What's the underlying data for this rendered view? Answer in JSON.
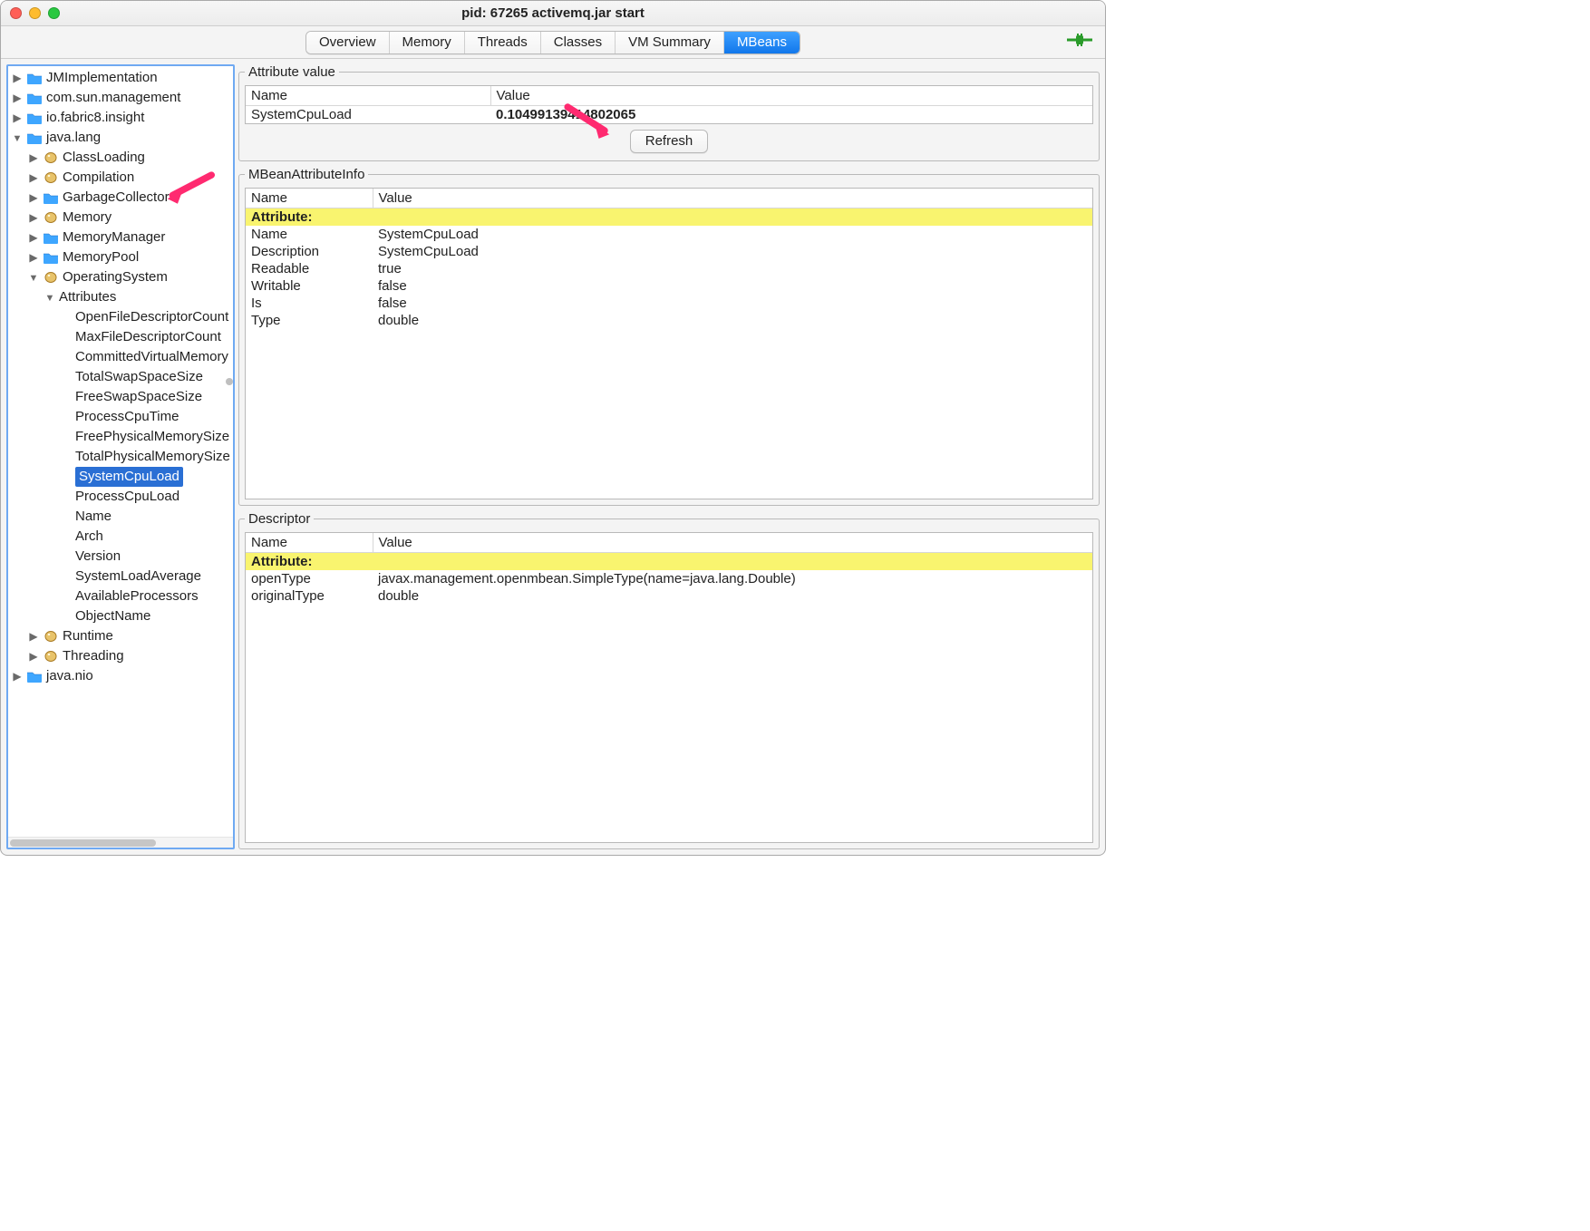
{
  "window": {
    "title": "pid: 67265 activemq.jar start"
  },
  "tabs": [
    "Overview",
    "Memory",
    "Threads",
    "Classes",
    "VM Summary",
    "MBeans"
  ],
  "active_tab": "MBeans",
  "tree": {
    "roots": [
      {
        "label": "JMImplementation",
        "icon": "folder",
        "expand": "closed"
      },
      {
        "label": "com.sun.management",
        "icon": "folder",
        "expand": "closed"
      },
      {
        "label": "io.fabric8.insight",
        "icon": "folder",
        "expand": "closed"
      },
      {
        "label": "java.lang",
        "icon": "folder",
        "expand": "open",
        "children": [
          {
            "label": "ClassLoading",
            "icon": "bean",
            "expand": "closed"
          },
          {
            "label": "Compilation",
            "icon": "bean",
            "expand": "closed"
          },
          {
            "label": "GarbageCollector",
            "icon": "folder",
            "expand": "closed",
            "annot_arrow": true
          },
          {
            "label": "Memory",
            "icon": "bean",
            "expand": "closed"
          },
          {
            "label": "MemoryManager",
            "icon": "folder",
            "expand": "closed"
          },
          {
            "label": "MemoryPool",
            "icon": "folder",
            "expand": "closed"
          },
          {
            "label": "OperatingSystem",
            "icon": "bean",
            "expand": "open",
            "children": [
              {
                "label": "Attributes",
                "expand": "open",
                "children": [
                  {
                    "label": "OpenFileDescriptorCount"
                  },
                  {
                    "label": "MaxFileDescriptorCount"
                  },
                  {
                    "label": "CommittedVirtualMemory"
                  },
                  {
                    "label": "TotalSwapSpaceSize"
                  },
                  {
                    "label": "FreeSwapSpaceSize"
                  },
                  {
                    "label": "ProcessCpuTime"
                  },
                  {
                    "label": "FreePhysicalMemorySize"
                  },
                  {
                    "label": "TotalPhysicalMemorySize"
                  },
                  {
                    "label": "SystemCpuLoad",
                    "selected": true
                  },
                  {
                    "label": "ProcessCpuLoad"
                  },
                  {
                    "label": "Name"
                  },
                  {
                    "label": "Arch"
                  },
                  {
                    "label": "Version"
                  },
                  {
                    "label": "SystemLoadAverage"
                  },
                  {
                    "label": "AvailableProcessors"
                  },
                  {
                    "label": "ObjectName"
                  }
                ]
              }
            ]
          },
          {
            "label": "Runtime",
            "icon": "bean",
            "expand": "closed"
          },
          {
            "label": "Threading",
            "icon": "bean",
            "expand": "closed"
          }
        ]
      },
      {
        "label": "java.nio",
        "icon": "folder",
        "expand": "closed"
      }
    ]
  },
  "attr_value": {
    "legend": "Attribute value",
    "name_header": "Name",
    "value_header": "Value",
    "name": "SystemCpuLoad",
    "value": "0.10499139414802065",
    "refresh_label": "Refresh",
    "annot_arrow": true
  },
  "mbean_info": {
    "legend": "MBeanAttributeInfo",
    "name_header": "Name",
    "value_header": "Value",
    "section": "Attribute:",
    "rows": [
      {
        "k": "Name",
        "v": "SystemCpuLoad"
      },
      {
        "k": "Description",
        "v": "SystemCpuLoad"
      },
      {
        "k": "Readable",
        "v": "true"
      },
      {
        "k": "Writable",
        "v": "false"
      },
      {
        "k": "Is",
        "v": "false"
      },
      {
        "k": "Type",
        "v": "double"
      }
    ]
  },
  "descriptor": {
    "legend": "Descriptor",
    "name_header": "Name",
    "value_header": "Value",
    "section": "Attribute:",
    "rows": [
      {
        "k": "openType",
        "v": "javax.management.openmbean.SimpleType(name=java.lang.Double)"
      },
      {
        "k": "originalType",
        "v": "double"
      }
    ]
  }
}
